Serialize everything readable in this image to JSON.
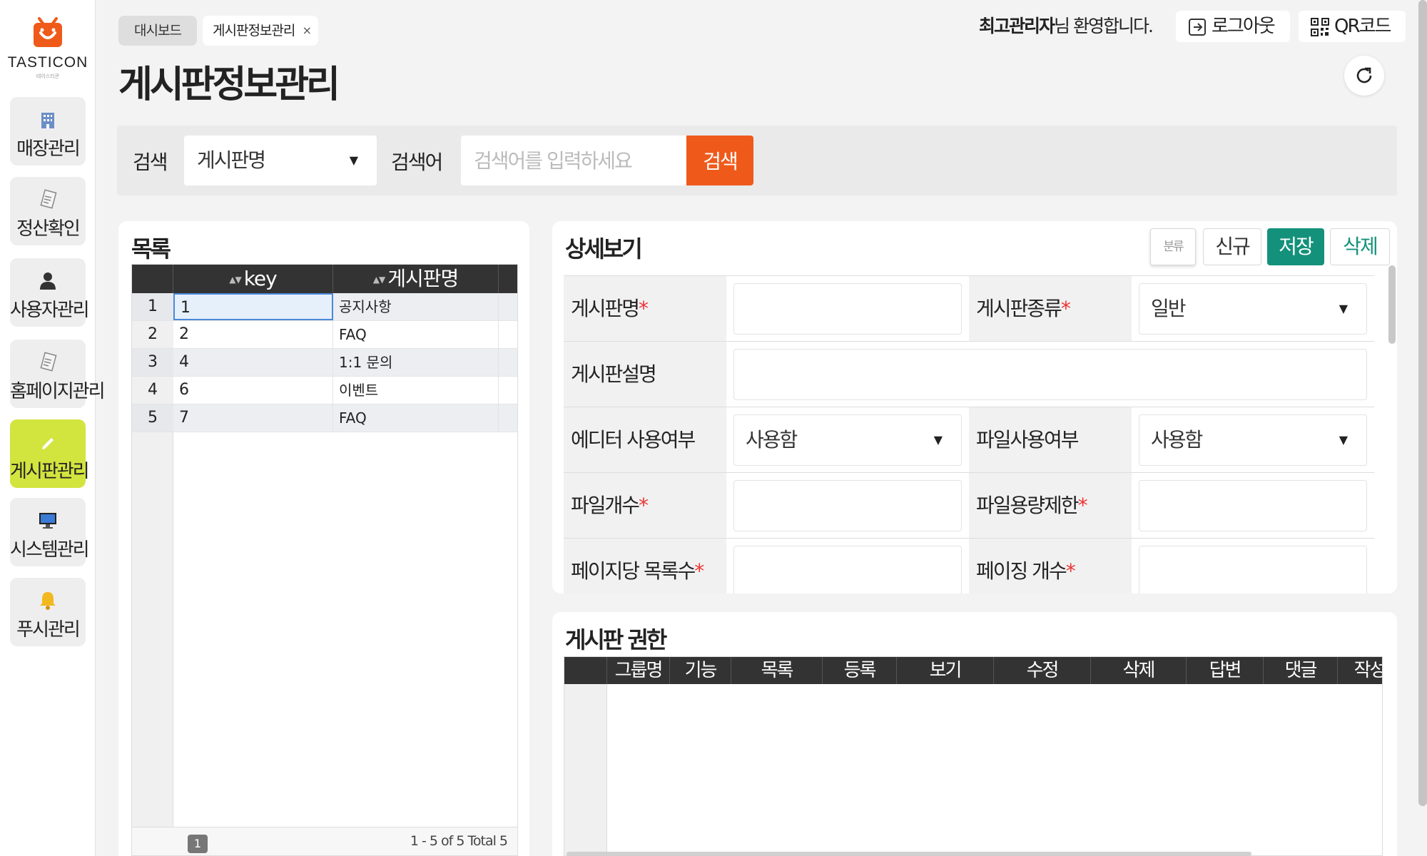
{
  "brand": {
    "name": "TASTICON",
    "sub": "테이스티콘",
    "accent": "#ef5a1b"
  },
  "sidebar": {
    "items": [
      {
        "label": "매장관리",
        "icon": "building-icon"
      },
      {
        "label": "정산확인",
        "icon": "receipt-icon"
      },
      {
        "label": "사용자관리",
        "icon": "user-icon"
      },
      {
        "label": "홈페이지관리",
        "icon": "document-icon"
      },
      {
        "label": "게시판관리",
        "icon": "pencil-icon",
        "active": true
      },
      {
        "label": "시스템관리",
        "icon": "monitor-icon"
      },
      {
        "label": "푸시관리",
        "icon": "bell-icon"
      }
    ],
    "active_color": "#d2e43e"
  },
  "tabs": [
    {
      "label": "대시보드"
    },
    {
      "label": "게시판정보관리",
      "close": "×"
    }
  ],
  "page_title": "게시판정보관리",
  "header": {
    "user_name": "최고관리자",
    "welcome_suffix": "님 환영합니다.",
    "logout_label": "로그아웃",
    "qr_label": "QR코드"
  },
  "search": {
    "label": "검색",
    "field_value": "게시판명",
    "keyword_label": "검색어",
    "placeholder": "검색어를 입력하세요",
    "button_label": "검색"
  },
  "list": {
    "title": "목록",
    "columns": [
      "key",
      "게시판명"
    ],
    "rows": [
      {
        "num": "1",
        "key": "1",
        "name": "공지사항"
      },
      {
        "num": "2",
        "key": "2",
        "name": "FAQ"
      },
      {
        "num": "3",
        "key": "4",
        "name": "1:1 문의"
      },
      {
        "num": "4",
        "key": "6",
        "name": "이벤트"
      },
      {
        "num": "5",
        "key": "7",
        "name": "FAQ"
      }
    ],
    "current_page": "1",
    "page_info": "1 - 5 of 5   Total 5"
  },
  "detail": {
    "title": "상세보기",
    "buttons": {
      "category": "분류",
      "new": "신규",
      "save": "저장",
      "delete": "삭제"
    },
    "save_color": "#14917a",
    "fields": {
      "board_name": "게시판명",
      "board_type": "게시판종류",
      "board_type_value": "일반",
      "board_desc": "게시판설명",
      "editor_use": "에디터 사용여부",
      "editor_use_value": "사용함",
      "file_use": "파일사용여부",
      "file_use_value": "사용함",
      "file_count": "파일개수",
      "file_size_limit": "파일용량제한",
      "per_page": "페이지당 목록수",
      "paging_count": "페이징 개수"
    },
    "required_mark": "*"
  },
  "permissions": {
    "title": "게시판 권한",
    "columns": [
      "그룹명",
      "기능",
      "목록",
      "등록",
      "보기",
      "수정",
      "삭제",
      "답변",
      "댓글",
      "작성"
    ]
  }
}
